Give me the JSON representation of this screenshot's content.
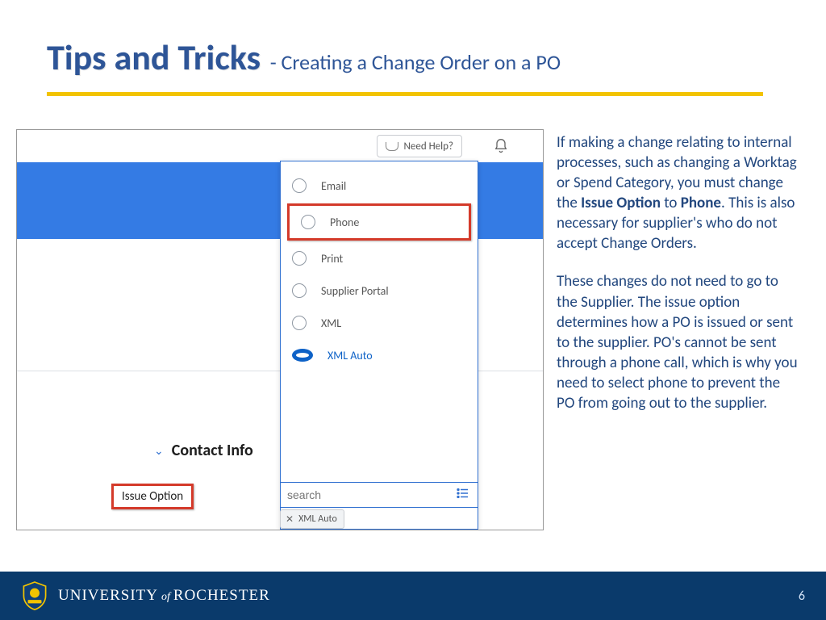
{
  "title": {
    "main": "Tips and Tricks",
    "sub": "- Creating a Change Order on a PO"
  },
  "screenshot": {
    "help_label": "Need Help?",
    "contact_heading": "Contact Info",
    "issue_label": "Issue Option",
    "search_placeholder": "search",
    "chip_value": "XML Auto",
    "options": {
      "o0": "Email",
      "o1": "Phone",
      "o2": "Print",
      "o3": "Supplier Portal",
      "o4": "XML",
      "o5": "XML Auto"
    }
  },
  "body": {
    "p1a": "If making a change relating to internal processes, such as changing a Worktag or Spend Category, you must change the ",
    "p1b": "Issue Option",
    "p1c": " to ",
    "p1d": "Phone",
    "p1e": ". This is also necessary for supplier's who do not accept Change Orders.",
    "p2": "These changes do not need to go to the Supplier.  The issue option determines how a PO is issued or sent to the supplier.  PO's cannot be sent through a phone call, which is why you need to select phone to prevent the PO from going out to the supplier."
  },
  "footer": {
    "university_a": "UNIVERSITY",
    "university_of": "of",
    "university_b": "ROCHESTER",
    "page": "6"
  }
}
